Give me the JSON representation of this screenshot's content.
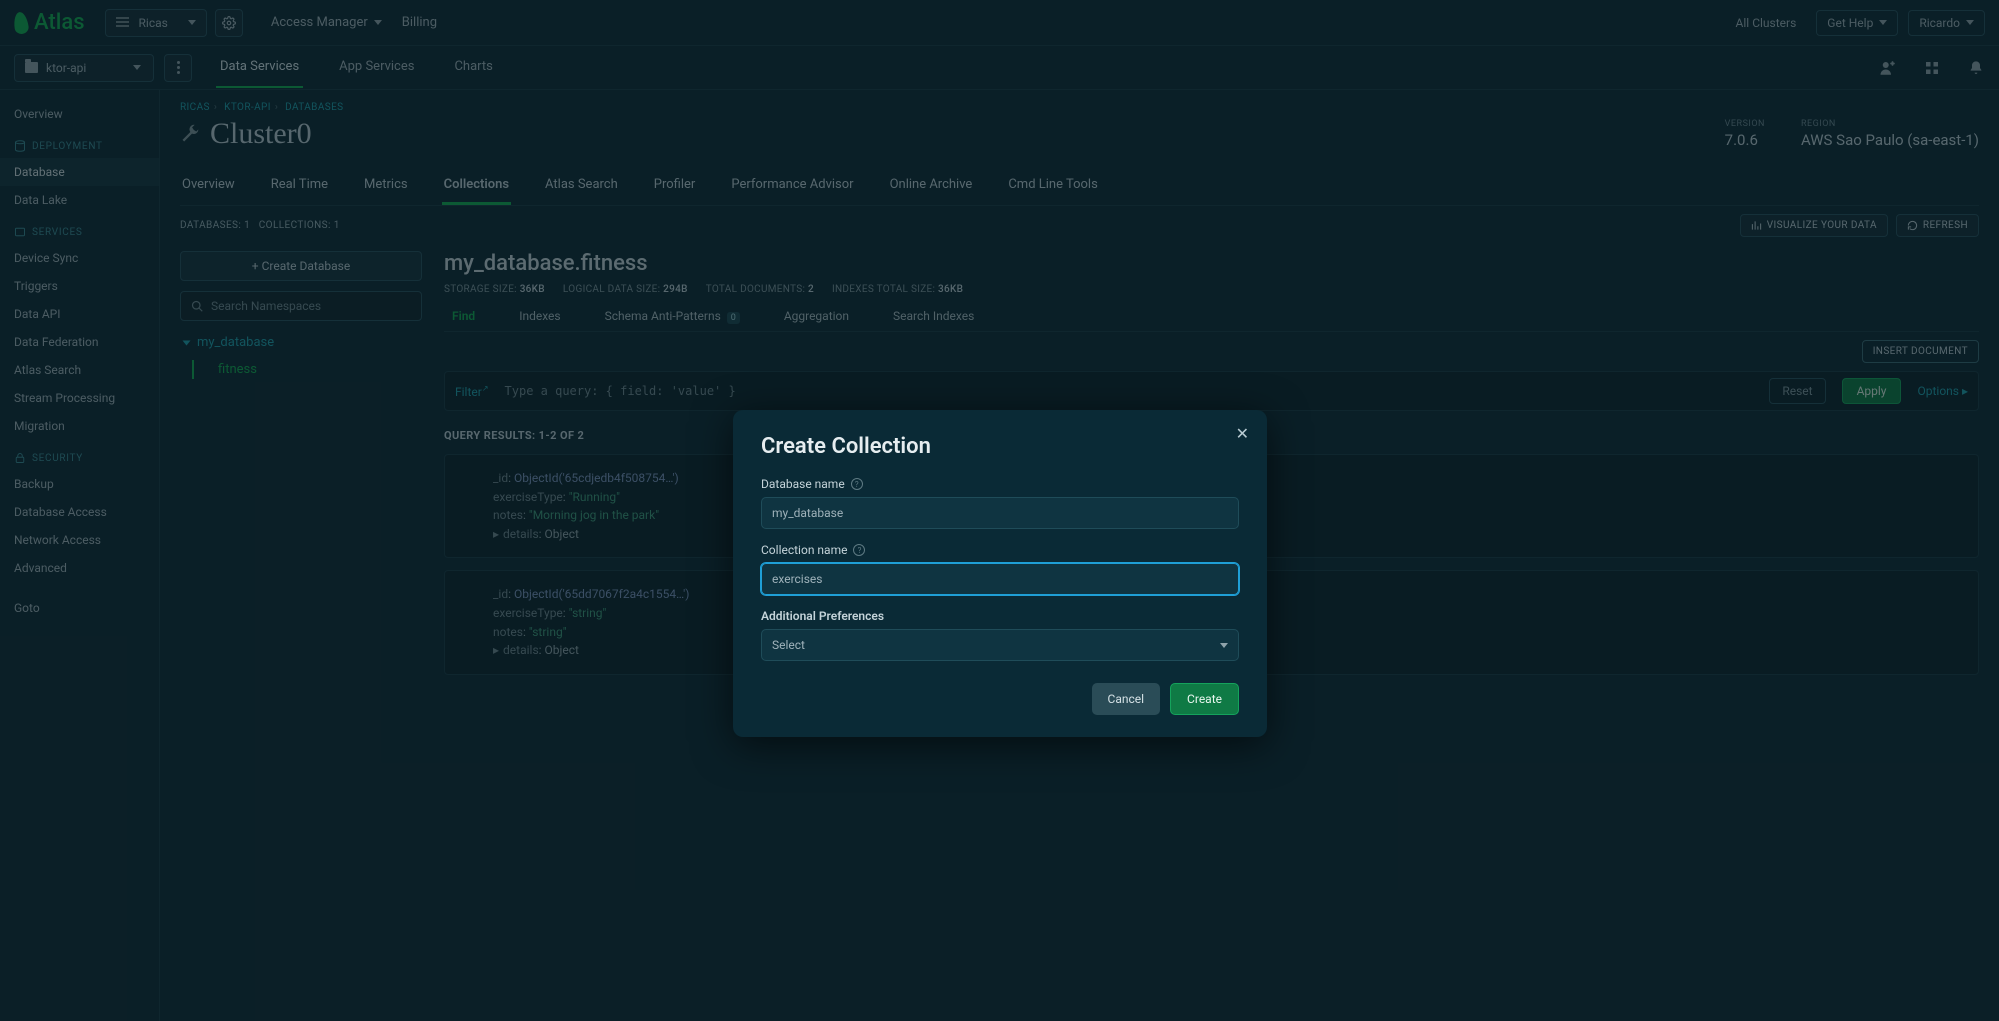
{
  "brand": "Atlas",
  "topbar": {
    "org_name": "Ricas",
    "access_manager": "Access Manager",
    "billing": "Billing",
    "all_clusters": "All Clusters",
    "get_help": "Get Help",
    "user": "Ricardo"
  },
  "secbar": {
    "project": "ktor-api",
    "tabs": {
      "data_services": "Data Services",
      "app_services": "App Services",
      "charts": "Charts"
    }
  },
  "sidebar": {
    "overview": "Overview",
    "deployment_hdr": "DEPLOYMENT",
    "database": "Database",
    "data_lake": "Data Lake",
    "services_hdr": "SERVICES",
    "device_sync": "Device Sync",
    "triggers": "Triggers",
    "data_api": "Data API",
    "data_federation": "Data Federation",
    "atlas_search": "Atlas Search",
    "stream_processing": "Stream Processing",
    "migration": "Migration",
    "security_hdr": "SECURITY",
    "backup": "Backup",
    "database_access": "Database Access",
    "network_access": "Network Access",
    "advanced": "Advanced",
    "goto": "Goto"
  },
  "crumbs": {
    "a": "RICAS",
    "b": "KTOR-API",
    "c": "DATABASES"
  },
  "cluster": {
    "name": "Cluster0",
    "version_lbl": "VERSION",
    "version": "7.0.6",
    "region_lbl": "REGION",
    "region": "AWS Sao Paulo (sa-east-1)"
  },
  "tabs": {
    "overview": "Overview",
    "realtime": "Real Time",
    "metrics": "Metrics",
    "collections": "Collections",
    "atlas_search": "Atlas Search",
    "profiler": "Profiler",
    "perf": "Performance Advisor",
    "archive": "Online Archive",
    "cmd": "Cmd Line Tools"
  },
  "counts": {
    "databases": "DATABASES: 1",
    "collections": "COLLECTIONS: 1"
  },
  "buttons": {
    "visualize": "VISUALIZE YOUR DATA",
    "refresh": "REFRESH",
    "create_db": "+  Create Database",
    "insert_doc": "INSERT DOCUMENT"
  },
  "ns": {
    "search_ph": "Search Namespaces",
    "db": "my_database",
    "coll": "fitness"
  },
  "coll": {
    "title": "my_database.fitness",
    "s1l": "STORAGE SIZE:",
    "s1v": "36KB",
    "s2l": "LOGICAL DATA SIZE:",
    "s2v": "294B",
    "s3l": "TOTAL DOCUMENTS:",
    "s3v": "2",
    "s4l": "INDEXES TOTAL SIZE:",
    "s4v": "36KB",
    "tabs": {
      "find": "Find",
      "indexes": "Indexes",
      "anti": "Schema Anti-Patterns",
      "anti_badge": "0",
      "agg": "Aggregation",
      "search": "Search Indexes"
    }
  },
  "filter": {
    "label": "Filter",
    "placeholder": "Type a query: { field: 'value' }",
    "reset": "Reset",
    "apply": "Apply",
    "options": "Options"
  },
  "results": {
    "hdr": "QUERY RESULTS: 1-2 OF 2"
  },
  "doc1": {
    "id_k": "_id",
    "id_v": "ObjectId('65cdjedb4f508754…')",
    "et_k": "exerciseType",
    "et_v": "\"Running\"",
    "n_k": "notes",
    "n_v": "\"Morning jog in the park\"",
    "d_k": "details",
    "d_v": "Object"
  },
  "doc2": {
    "id_k": "_id",
    "id_v": "ObjectId('65dd7067f2a4c1554…')",
    "et_k": "exerciseType",
    "et_v": "\"string\"",
    "n_k": "notes",
    "n_v": "\"string\"",
    "d_k": "details",
    "d_v": "Object"
  },
  "modal": {
    "title": "Create Collection",
    "db_label": "Database name",
    "db_value": "my_database",
    "coll_label": "Collection name",
    "coll_value": "exercises",
    "pref_label": "Additional Preferences",
    "pref_value": "Select",
    "cancel": "Cancel",
    "create": "Create"
  }
}
